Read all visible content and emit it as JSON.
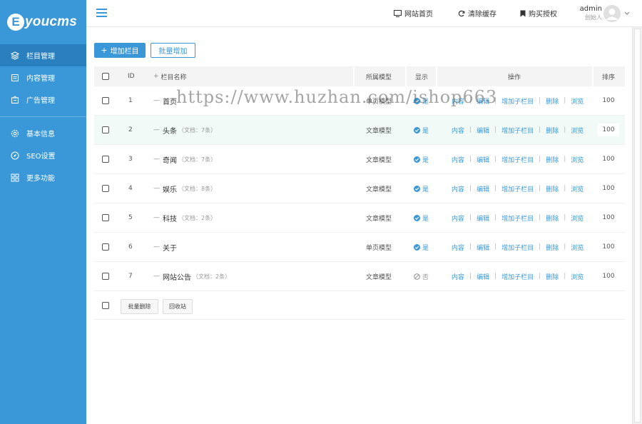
{
  "brand": {
    "badge": "E",
    "text": "youcms"
  },
  "sidebar": {
    "items": [
      {
        "label": "栏目管理",
        "icon": "layers-icon",
        "active": true
      },
      {
        "label": "内容管理",
        "icon": "document-icon",
        "active": false
      },
      {
        "label": "广告管理",
        "icon": "ad-icon",
        "active": false
      }
    ],
    "items2": [
      {
        "label": "基本信息",
        "icon": "gear-icon"
      },
      {
        "label": "SEO设置",
        "icon": "compass-icon"
      },
      {
        "label": "更多功能",
        "icon": "grid-icon"
      }
    ]
  },
  "header": {
    "links": [
      {
        "label": "网站首页",
        "icon": "monitor-icon"
      },
      {
        "label": "清除缓存",
        "icon": "refresh-icon"
      },
      {
        "label": "购买授权",
        "icon": "bookmark-icon"
      }
    ],
    "user": {
      "name": "admin",
      "role": "创始人"
    }
  },
  "toolbar": {
    "add_label": "增加栏目",
    "batch_add_label": "批量增加"
  },
  "table": {
    "headers": {
      "id": "ID",
      "name": "栏目名称",
      "model": "所属模型",
      "show": "显示",
      "ops": "操作",
      "sort": "排序"
    },
    "rows": [
      {
        "id": "1",
        "name": "首页",
        "count": "",
        "model": "单页模型",
        "show": "是",
        "visible": true,
        "sort": "100"
      },
      {
        "id": "2",
        "name": "头条",
        "count": "（文档：7条）",
        "model": "文章模型",
        "show": "是",
        "visible": true,
        "sort": "100"
      },
      {
        "id": "3",
        "name": "奇闻",
        "count": "（文档：7条）",
        "model": "文章模型",
        "show": "是",
        "visible": true,
        "sort": "100"
      },
      {
        "id": "4",
        "name": "娱乐",
        "count": "（文档：8条）",
        "model": "文章模型",
        "show": "是",
        "visible": true,
        "sort": "100"
      },
      {
        "id": "5",
        "name": "科技",
        "count": "（文档：2条）",
        "model": "文章模型",
        "show": "是",
        "visible": true,
        "sort": "100"
      },
      {
        "id": "6",
        "name": "关于",
        "count": "",
        "model": "单页模型",
        "show": "是",
        "visible": true,
        "sort": "100"
      },
      {
        "id": "7",
        "name": "网站公告",
        "count": "（文档：2条）",
        "model": "文章模型",
        "show": "否",
        "visible": false,
        "sort": "100"
      }
    ],
    "op_labels": {
      "content": "内容",
      "edit": "编辑",
      "add_child": "增加子栏目",
      "delete": "删除",
      "browse": "浏览"
    },
    "footer": {
      "batch_delete": "批量删除",
      "recycle": "回收站"
    }
  },
  "watermark": "https://www.huzhan.com/ishop663",
  "colors": {
    "primary": "#3a98d8",
    "sidebar_active": "#2a7fbf",
    "row_highlight": "#f1faf7"
  }
}
